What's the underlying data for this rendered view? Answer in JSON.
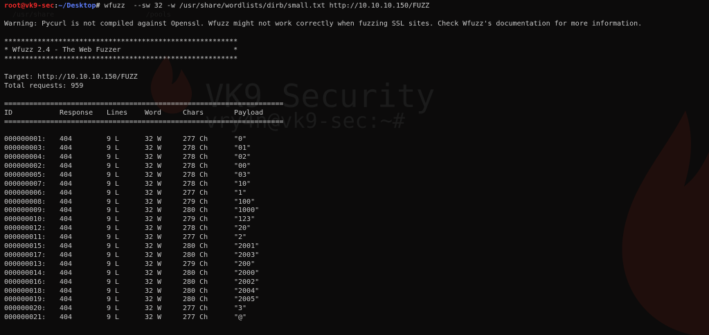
{
  "prompt": {
    "user_host": "root@vk9-sec",
    "path": "~/Desktop",
    "symbol": "#",
    "command": " wfuzz  --sw 32 -w /usr/share/wordlists/dirb/small.txt http://10.10.10.150/FUZZ"
  },
  "warning": "Warning: Pycurl is not compiled against Openssl. Wfuzz might not work correctly when fuzzing SSL sites. Check Wfuzz's documentation for more information.",
  "banner": {
    "border": "********************************************************",
    "title": "* Wfuzz 2.4 - The Web Fuzzer                           *"
  },
  "target": "Target: http://10.10.10.150/FUZZ",
  "total_requests": "Total requests: 959",
  "separator": "===================================================================",
  "headers": [
    "ID",
    "Response",
    "Lines",
    "Word",
    "Chars",
    "Payload"
  ],
  "rows": [
    [
      "000000001:",
      "404",
      "9 L",
      "32 W",
      "277 Ch",
      "\"0\""
    ],
    [
      "000000003:",
      "404",
      "9 L",
      "32 W",
      "278 Ch",
      "\"01\""
    ],
    [
      "000000004:",
      "404",
      "9 L",
      "32 W",
      "278 Ch",
      "\"02\""
    ],
    [
      "000000002:",
      "404",
      "9 L",
      "32 W",
      "278 Ch",
      "\"00\""
    ],
    [
      "000000005:",
      "404",
      "9 L",
      "32 W",
      "278 Ch",
      "\"03\""
    ],
    [
      "000000007:",
      "404",
      "9 L",
      "32 W",
      "278 Ch",
      "\"10\""
    ],
    [
      "000000006:",
      "404",
      "9 L",
      "32 W",
      "277 Ch",
      "\"1\""
    ],
    [
      "000000008:",
      "404",
      "9 L",
      "32 W",
      "279 Ch",
      "\"100\""
    ],
    [
      "000000009:",
      "404",
      "9 L",
      "32 W",
      "280 Ch",
      "\"1000\""
    ],
    [
      "000000010:",
      "404",
      "9 L",
      "32 W",
      "279 Ch",
      "\"123\""
    ],
    [
      "000000012:",
      "404",
      "9 L",
      "32 W",
      "278 Ch",
      "\"20\""
    ],
    [
      "000000011:",
      "404",
      "9 L",
      "32 W",
      "277 Ch",
      "\"2\""
    ],
    [
      "000000015:",
      "404",
      "9 L",
      "32 W",
      "280 Ch",
      "\"2001\""
    ],
    [
      "000000017:",
      "404",
      "9 L",
      "32 W",
      "280 Ch",
      "\"2003\""
    ],
    [
      "000000013:",
      "404",
      "9 L",
      "32 W",
      "279 Ch",
      "\"200\""
    ],
    [
      "000000014:",
      "404",
      "9 L",
      "32 W",
      "280 Ch",
      "\"2000\""
    ],
    [
      "000000016:",
      "404",
      "9 L",
      "32 W",
      "280 Ch",
      "\"2002\""
    ],
    [
      "000000018:",
      "404",
      "9 L",
      "32 W",
      "280 Ch",
      "\"2004\""
    ],
    [
      "000000019:",
      "404",
      "9 L",
      "32 W",
      "280 Ch",
      "\"2005\""
    ],
    [
      "000000020:",
      "404",
      "9 L",
      "32 W",
      "277 Ch",
      "\"3\""
    ],
    [
      "000000021:",
      "404",
      "9 L",
      "32 W",
      "277 Ch",
      "\"@\""
    ]
  ],
  "background": {
    "watermark_line1": "VK9 Security",
    "watermark_line2": "vry4n@vk9-sec:~#",
    "ghost_text": "/usr/share                      /pools",
    "colors": {
      "background": "#0c0b0b",
      "text": "#c8c8c8",
      "user": "#ef2929",
      "path": "#5c7cfa",
      "flame": "#2a1212"
    }
  }
}
